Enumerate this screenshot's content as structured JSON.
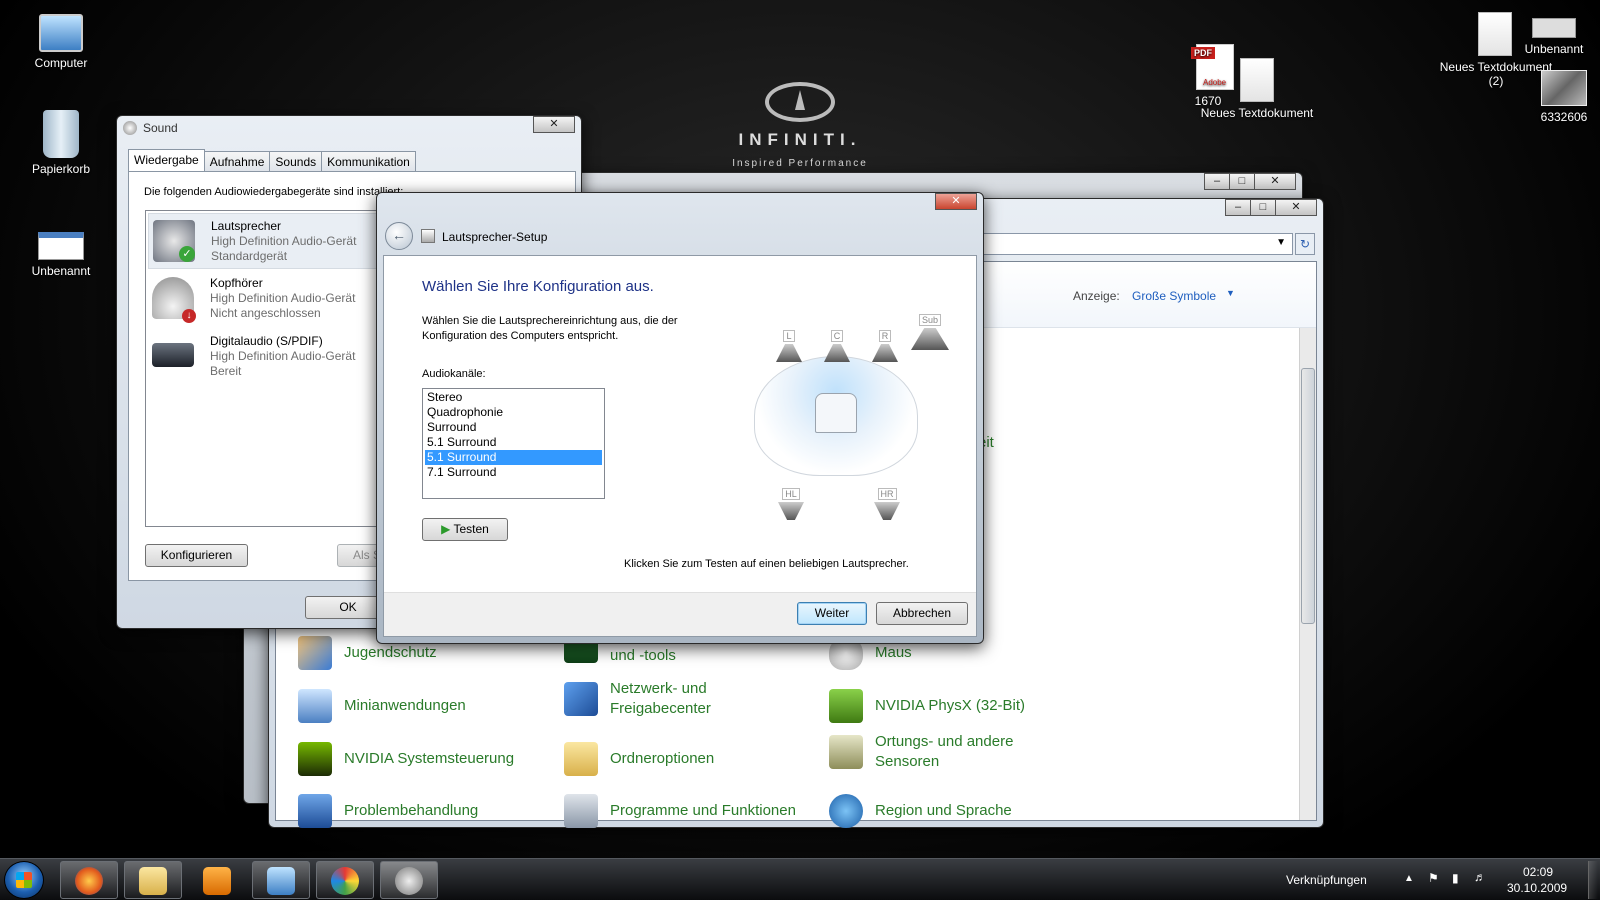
{
  "desktop": {
    "icons_left": [
      "Computer",
      "Papierkorb",
      "Unbenannt"
    ],
    "icons_top": {
      "pdf": "1670",
      "pdf_badge": "PDF",
      "pdf_brand": "Adobe",
      "textdoc": "Neues Textdokument"
    },
    "icons_right": {
      "textdoc2_line1": "Neues Textdokument",
      "textdoc2_line2": "(2)",
      "unbenannt": "Unbenannt",
      "photo": "6332606"
    },
    "brand_name": "INFINITI.",
    "brand_tag": "Inspired Performance"
  },
  "control_panel": {
    "view_label": "Anzeige:",
    "view_value": "Große Symbole",
    "partial_text": "eit",
    "items": [
      [
        "Jugendschutz",
        "Leistungsinformationen und -tools",
        "Maus"
      ],
      [
        "Minianwendungen",
        "Netzwerk- und Freigabecenter",
        "NVIDIA PhysX (32-Bit)"
      ],
      [
        "NVIDIA Systemsteuerung",
        "Ordneroptionen",
        "Ortungs- und andere Sensoren"
      ],
      [
        "Problembehandlung",
        "Programme und Funktionen",
        "Region und Sprache"
      ]
    ]
  },
  "sound_dialog": {
    "title": "Sound",
    "tabs": [
      "Wiedergabe",
      "Aufnahme",
      "Sounds",
      "Kommunikation"
    ],
    "intro": "Die folgenden Audiowiedergabegeräte sind installiert:",
    "devices": [
      {
        "name": "Lautsprecher",
        "driver": "High Definition Audio-Gerät",
        "status": "Standardgerät"
      },
      {
        "name": "Kopfhörer",
        "driver": "High Definition Audio-Gerät",
        "status": "Nicht angeschlossen"
      },
      {
        "name": "Digitalaudio (S/PDIF)",
        "driver": "High Definition Audio-Gerät",
        "status": "Bereit"
      }
    ],
    "configure_button": "Konfigurieren",
    "default_button": "Als S",
    "ok_button": "OK"
  },
  "speaker_setup": {
    "title": "Lautsprecher-Setup",
    "heading": "Wählen Sie Ihre Konfiguration aus.",
    "description_line1": "Wählen Sie die Lautsprechereinrichtung aus, die der",
    "description_line2": "Konfiguration des Computers entspricht.",
    "channels_label": "Audiokanäle:",
    "options": [
      "Stereo",
      "Quadrophonie",
      "Surround",
      "5.1 Surround",
      "5.1 Surround",
      "7.1 Surround"
    ],
    "selected_index": 4,
    "test_button": "Testen",
    "hint": "Klicken Sie zum Testen auf einen beliebigen Lautsprecher.",
    "speaker_labels": {
      "l": "L",
      "c": "C",
      "r": "R",
      "sub": "Sub",
      "hl": "HL",
      "hr": "HR"
    },
    "next_button": "Weiter",
    "cancel_button": "Abbrechen"
  },
  "taskbar": {
    "links_label": "Verknüpfungen",
    "time": "02:09",
    "date": "30.10.2009"
  }
}
